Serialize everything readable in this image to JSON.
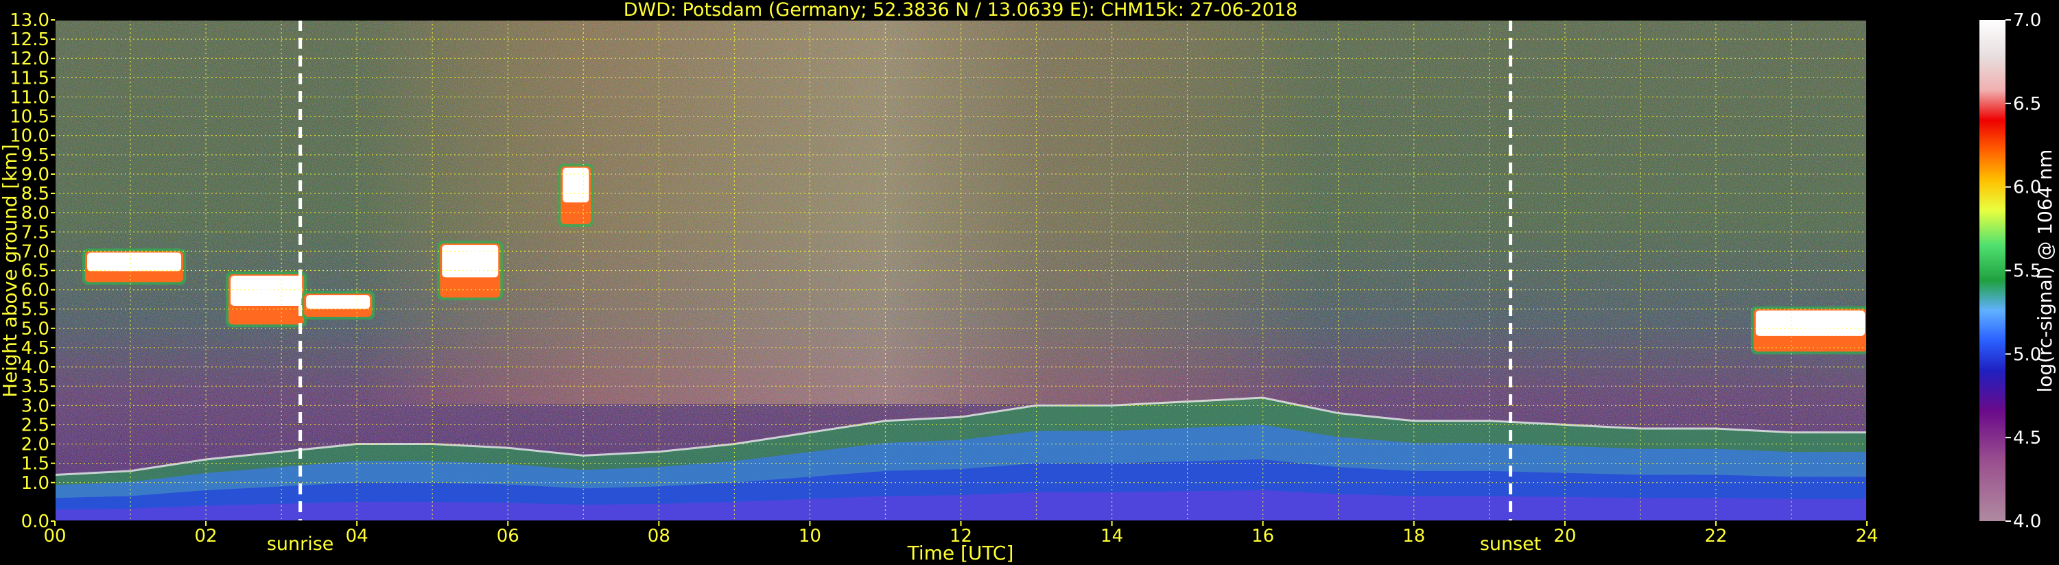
{
  "chart_data": {
    "type": "heatmap",
    "title": "DWD: Potsdam (Germany; 52.3836 N / 13.0639 E):    CHM15k: 27-06-2018",
    "xlabel": "Time [UTC]",
    "ylabel": "Height above ground [km]",
    "x_ticks": [
      "00",
      "02",
      "04",
      "06",
      "08",
      "10",
      "12",
      "14",
      "16",
      "18",
      "20",
      "22",
      "24"
    ],
    "y_ticks": [
      "0.0",
      "1.0",
      "1.5",
      "2.0",
      "2.5",
      "3.0",
      "3.5",
      "4.0",
      "4.5",
      "5.0",
      "5.5",
      "6.0",
      "6.5",
      "7.0",
      "7.5",
      "8.0",
      "8.5",
      "9.0",
      "9.5",
      "10.0",
      "10.5",
      "11.0",
      "11.5",
      "12.0",
      "12.5",
      "13.0"
    ],
    "xlim": [
      0,
      24
    ],
    "ylim": [
      0,
      13
    ],
    "grid": true,
    "colorbar": {
      "label": "log(rc-signal) @ 1064 nm",
      "range": [
        4.0,
        7.0
      ],
      "ticks": [
        "4.0",
        "4.5",
        "5.0",
        "5.5",
        "6.0",
        "6.5",
        "7.0"
      ]
    },
    "events": [
      {
        "label": "sunrise",
        "time_utc": 3.25
      },
      {
        "label": "sunset",
        "time_utc": 19.28
      }
    ],
    "features": {
      "boundary_layer_top_km": [
        [
          0,
          1.2
        ],
        [
          1,
          1.3
        ],
        [
          2,
          1.6
        ],
        [
          3,
          1.8
        ],
        [
          4,
          2.0
        ],
        [
          5,
          2.0
        ],
        [
          6,
          1.9
        ],
        [
          7,
          1.7
        ],
        [
          8,
          1.8
        ],
        [
          9,
          2.0
        ],
        [
          10,
          2.3
        ],
        [
          11,
          2.6
        ],
        [
          12,
          2.7
        ],
        [
          13,
          3.0
        ],
        [
          14,
          3.0
        ],
        [
          15,
          3.1
        ],
        [
          16,
          3.2
        ],
        [
          17,
          2.8
        ],
        [
          18,
          2.6
        ],
        [
          19,
          2.6
        ],
        [
          20,
          2.5
        ],
        [
          21,
          2.4
        ],
        [
          22,
          2.4
        ],
        [
          23,
          2.3
        ],
        [
          24,
          2.3
        ]
      ],
      "cloud_layers": [
        {
          "start": 0.4,
          "end": 1.7,
          "base_km": 6.2,
          "top_km": 7.0
        },
        {
          "start": 2.3,
          "end": 3.3,
          "base_km": 5.1,
          "top_km": 6.4
        },
        {
          "start": 3.3,
          "end": 4.2,
          "base_km": 5.3,
          "top_km": 5.9
        },
        {
          "start": 5.1,
          "end": 5.9,
          "base_km": 5.8,
          "top_km": 7.2
        },
        {
          "start": 6.7,
          "end": 7.1,
          "base_km": 7.7,
          "top_km": 9.2
        },
        {
          "start": 22.5,
          "end": 24.0,
          "base_km": 4.4,
          "top_km": 5.5
        }
      ]
    }
  }
}
